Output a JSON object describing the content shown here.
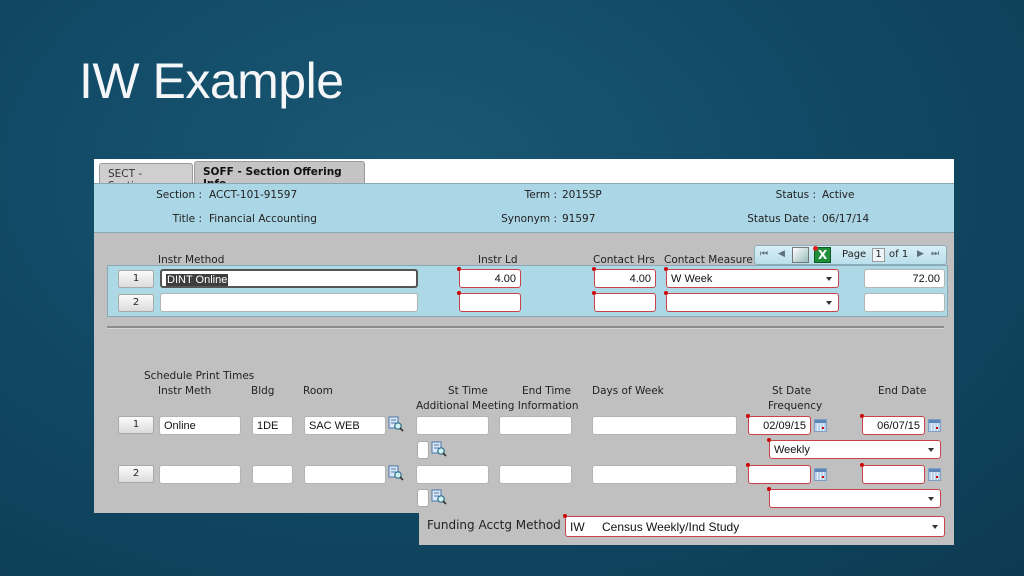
{
  "slide": {
    "title": "IW Example"
  },
  "tabs": [
    {
      "label": "SECT - Sections",
      "active": false
    },
    {
      "label": "SOFF - Section Offering Info",
      "active": true
    }
  ],
  "header": {
    "section_label": "Section :",
    "section_value": "ACCT-101-91597",
    "title_label": "Title :",
    "title_value": "Financial Accounting",
    "term_label": "Term :",
    "term_value": "2015SP",
    "synonym_label": "Synonym :",
    "synonym_value": "91597",
    "status_label": "Status :",
    "status_value": "Active",
    "status_date_label": "Status Date :",
    "status_date_value": "06/17/14"
  },
  "instr_grid": {
    "columns": {
      "instr_method": "Instr Method",
      "instr_ld": "Instr Ld",
      "contact_hrs": "Contact Hrs",
      "contact_measure": "Contact Measure"
    },
    "pager": {
      "page_label": "Page",
      "page": "1",
      "of_label": "of 1",
      "first": "⏮",
      "prev": "◀",
      "next": "▶",
      "last": "⏭"
    },
    "rows": [
      {
        "num": "1",
        "instr_method": "DINT Online",
        "instr_ld": "4.00",
        "contact_hrs": "4.00",
        "contact_measure": "W Week",
        "total": "72.00"
      },
      {
        "num": "2",
        "instr_method": "",
        "instr_ld": "",
        "contact_hrs": "",
        "contact_measure": "",
        "total": ""
      }
    ]
  },
  "schedule": {
    "title": "Schedule Print Times",
    "columns": {
      "instr_meth": "Instr Meth",
      "bldg": "Bldg",
      "room": "Room",
      "st_time": "St Time",
      "end_time": "End Time",
      "additional_info": "Additional Meeting Information",
      "days_of_week": "Days of Week",
      "st_date": "St Date",
      "frequency": "Frequency",
      "end_date": "End Date"
    },
    "rows": [
      {
        "num": "1",
        "instr_meth": "Online",
        "bldg": "1DE",
        "room": "SAC WEB",
        "st_time": "",
        "end_time": "",
        "days": "",
        "st_date": "02/09/15",
        "end_date": "06/07/15",
        "frequency": "Weekly"
      },
      {
        "num": "2",
        "instr_meth": "",
        "bldg": "",
        "room": "",
        "st_time": "",
        "end_time": "",
        "days": "",
        "st_date": "",
        "end_date": "",
        "frequency": ""
      }
    ]
  },
  "funding": {
    "label": "Funding Acctg Method",
    "code": "IW",
    "value": "Census Weekly/Ind Study"
  }
}
